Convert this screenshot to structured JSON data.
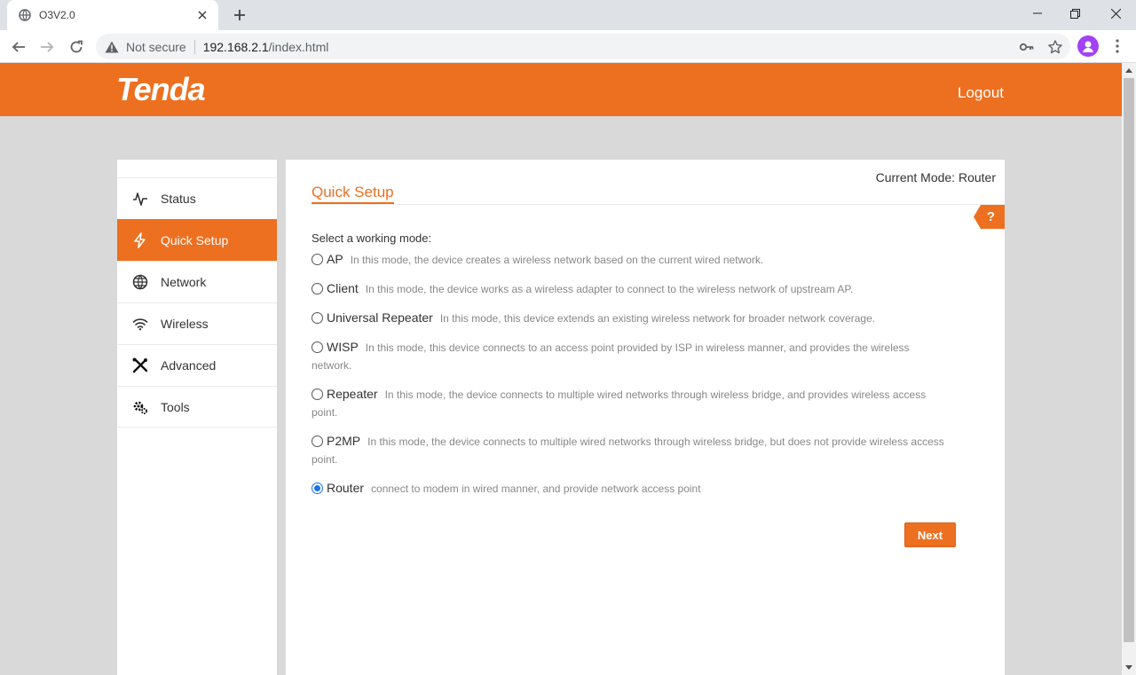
{
  "browser": {
    "tab_title": "O3V2.0",
    "security_label": "Not secure",
    "url_host": "192.168.2.1",
    "url_path": "/index.html"
  },
  "header": {
    "logo_text": "Tenda",
    "logout_label": "Logout",
    "brand_color": "#ed7020"
  },
  "sidebar": {
    "items": [
      {
        "label": "Status",
        "icon": "pulse-icon",
        "active": false
      },
      {
        "label": "Quick Setup",
        "icon": "lightning-icon",
        "active": true
      },
      {
        "label": "Network",
        "icon": "globe-icon",
        "active": false
      },
      {
        "label": "Wireless",
        "icon": "wifi-icon",
        "active": false
      },
      {
        "label": "Advanced",
        "icon": "tools-icon",
        "active": false
      },
      {
        "label": "Tools",
        "icon": "gears-icon",
        "active": false
      }
    ]
  },
  "main": {
    "current_mode": "Current Mode: Router",
    "title": "Quick Setup",
    "help_label": "?",
    "prompt": "Select a working mode:",
    "modes": [
      {
        "name": "AP",
        "description": "In this mode, the device creates a wireless network based on the current wired network.",
        "selected": false
      },
      {
        "name": "Client",
        "description": "In this mode, the device works as a wireless adapter to connect to the wireless network of upstream AP.",
        "selected": false
      },
      {
        "name": "Universal Repeater",
        "description": "In this mode, this device extends an existing wireless network for broader network coverage.",
        "selected": false
      },
      {
        "name": "WISP",
        "description": "In this mode, this device connects to an access point provided by ISP in wireless manner, and provides the wireless network.",
        "selected": false
      },
      {
        "name": "Repeater",
        "description": "In this mode, the device connects to multiple wired networks through wireless bridge, and provides wireless access point.",
        "selected": false
      },
      {
        "name": "P2MP",
        "description": "In this mode, the device connects to multiple wired networks through wireless bridge, but does not provide wireless access point.",
        "selected": false
      },
      {
        "name": "Router",
        "description": "connect to modem in wired manner, and provide network access point",
        "selected": true
      }
    ],
    "next_label": "Next"
  }
}
